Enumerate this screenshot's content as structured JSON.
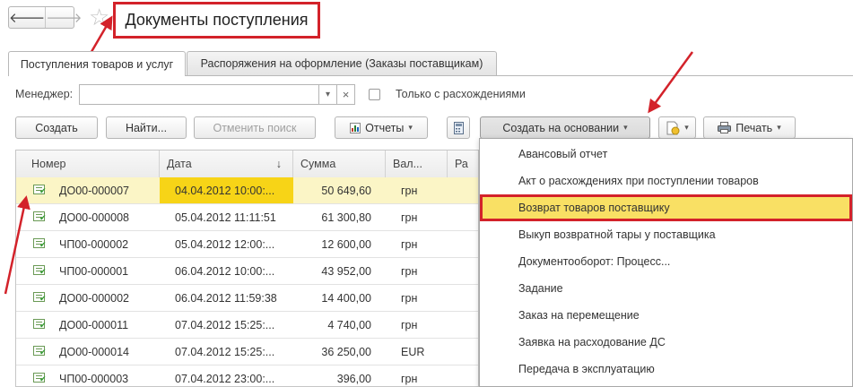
{
  "nav": {
    "back": "🡐",
    "forward": "🡒",
    "star": "☆"
  },
  "title": "Документы поступления",
  "tabs": [
    {
      "label": "Поступления товаров и услуг",
      "active": true
    },
    {
      "label": "Распоряжения на оформление (Заказы поставщикам)",
      "active": false
    }
  ],
  "filter": {
    "manager_label": "Менеджер:",
    "manager_value": "",
    "dropdown_glyph": "▾",
    "clear_glyph": "×",
    "discrepancy_label": "Только с расхождениями",
    "discrepancy_checked": false
  },
  "toolbar": {
    "create": "Создать",
    "find": "Найти...",
    "cancel_search": "Отменить поиск",
    "reports": "Отчеты",
    "create_based_on": "Создать на основании",
    "print": "Печать",
    "caret": "▾"
  },
  "table": {
    "columns": [
      "Номер",
      "Дата",
      "Сумма",
      "Вал...",
      "Ра"
    ],
    "sort_glyph": "↓",
    "rows": [
      {
        "number": "ДО00-000007",
        "date": "04.04.2012 10:00:...",
        "sum": "50 649,60",
        "currency": "грн",
        "selected": true
      },
      {
        "number": "ДО00-000008",
        "date": "05.04.2012 11:11:51",
        "sum": "61 300,80",
        "currency": "грн",
        "selected": false
      },
      {
        "number": "ЧП00-000002",
        "date": "05.04.2012 12:00:...",
        "sum": "12 600,00",
        "currency": "грн",
        "selected": false
      },
      {
        "number": "ЧП00-000001",
        "date": "06.04.2012 10:00:...",
        "sum": "43 952,00",
        "currency": "грн",
        "selected": false
      },
      {
        "number": "ДО00-000002",
        "date": "06.04.2012 11:59:38",
        "sum": "14 400,00",
        "currency": "грн",
        "selected": false
      },
      {
        "number": "ДО00-000011",
        "date": "07.04.2012 15:25:...",
        "sum": "4 740,00",
        "currency": "грн",
        "selected": false
      },
      {
        "number": "ДО00-000014",
        "date": "07.04.2012 15:25:...",
        "sum": "36 250,00",
        "currency": "EUR",
        "selected": false
      },
      {
        "number": "ЧП00-000003",
        "date": "07.04.2012 23:00:...",
        "sum": "396,00",
        "currency": "грн",
        "selected": false
      }
    ]
  },
  "menu": {
    "items": [
      "Авансовый отчет",
      "Акт о расхождениях при поступлении товаров",
      "Возврат товаров поставщику",
      "Выкуп возвратной тары у поставщика",
      "Документооборот: Процесс...",
      "Задание",
      "Заказ на перемещение",
      "Заявка на расходование ДС",
      "Передача в эксплуатацию"
    ],
    "highlighted_index": 2
  },
  "colors": {
    "annotation_red": "#d3222a",
    "highlight_yellow": "#f9e064",
    "selected_row": "#fbf5c6"
  }
}
